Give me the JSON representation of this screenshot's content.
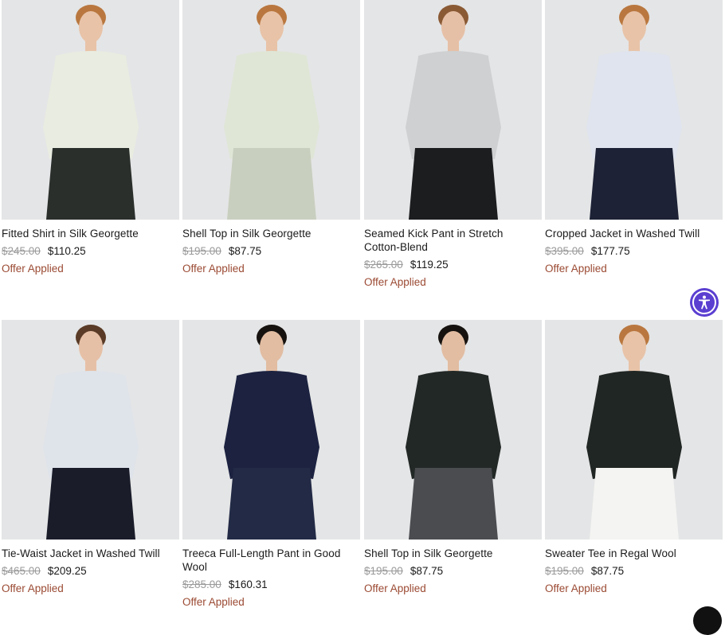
{
  "products": [
    {
      "name": "Fitted Shirt in Silk Georgette",
      "original_price": "$245.00",
      "sale_price": "$110.25",
      "badge": "Offer Applied",
      "colors": {
        "top": "#e9ece0",
        "bottom": "#2a2f2c",
        "skin": "#e8c3a8",
        "hair": "#b9773f"
      }
    },
    {
      "name": "Shell Top in Silk Georgette",
      "original_price": "$195.00",
      "sale_price": "$87.75",
      "badge": "Offer Applied",
      "colors": {
        "top": "#dfe6d6",
        "bottom": "#c9cfbf",
        "skin": "#e8c3a8",
        "hair": "#b9773f"
      }
    },
    {
      "name": "Seamed Kick Pant in Stretch Cotton-Blend",
      "original_price": "$265.00",
      "sale_price": "$119.25",
      "badge": "Offer Applied",
      "colors": {
        "top": "#cfd0d1",
        "bottom": "#1c1d1f",
        "skin": "#e6c0a6",
        "hair": "#8a5a35"
      }
    },
    {
      "name": "Cropped Jacket in Washed Twill",
      "original_price": "$395.00",
      "sale_price": "$177.75",
      "badge": "Offer Applied",
      "colors": {
        "top": "#dfe4ee",
        "bottom": "#1d2236",
        "skin": "#e8c3a8",
        "hair": "#b9773f"
      }
    },
    {
      "name": "Tie-Waist Jacket in Washed Twill",
      "original_price": "$465.00",
      "sale_price": "$209.25",
      "badge": "Offer Applied",
      "colors": {
        "top": "#dfe3ea",
        "bottom": "#1a1c2a",
        "skin": "#e6c0a6",
        "hair": "#5a3b27"
      }
    },
    {
      "name": "Treeca Full-Length Pant in Good Wool",
      "original_price": "$285.00",
      "sale_price": "$160.31",
      "badge": "Offer Applied",
      "colors": {
        "top": "#1c2240",
        "bottom": "#222a45",
        "skin": "#e2bda2",
        "hair": "#16120f"
      }
    },
    {
      "name": "Shell Top in Silk Georgette",
      "original_price": "$195.00",
      "sale_price": "$87.75",
      "badge": "Offer Applied",
      "colors": {
        "top": "#222826",
        "bottom": "#4a4c50",
        "skin": "#e2bda2",
        "hair": "#16120f"
      }
    },
    {
      "name": "Sweater Tee in Regal Wool",
      "original_price": "$195.00",
      "sale_price": "$87.75",
      "badge": "Offer Applied",
      "colors": {
        "top": "#202623",
        "bottom": "#f4f4f2",
        "skin": "#e8c3a8",
        "hair": "#b9773f"
      }
    }
  ],
  "accessibility_button": {
    "icon": "accessibility-person-icon",
    "color": "#5b3fd1"
  },
  "chat_widget": {
    "icon": "chat-bubble-icon",
    "color": "#111111"
  }
}
